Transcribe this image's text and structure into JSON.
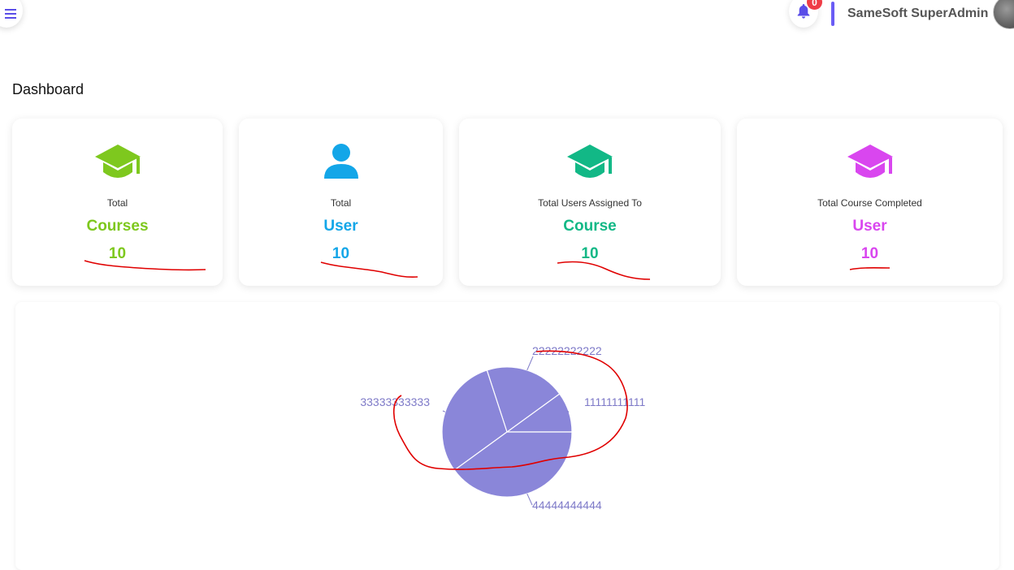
{
  "header": {
    "user_name": "SameSoft SuperAdmin",
    "notification_count": "0",
    "accent_color": "#6a5cf5"
  },
  "page": {
    "title": "Dashboard"
  },
  "cards": [
    {
      "icon": "graduation-cap-icon",
      "small": "Total",
      "big": "Courses",
      "value": "10",
      "color": "#7ec81e"
    },
    {
      "icon": "user-icon",
      "small": "Total",
      "big": "User",
      "value": "10",
      "color": "#13a6e8"
    },
    {
      "icon": "graduation-cap-icon",
      "small": "Total Users Assigned To",
      "big": "Course",
      "value": "10",
      "color": "#12b886"
    },
    {
      "icon": "graduation-cap-icon",
      "small": "Total Course Completed",
      "big": "User",
      "value": "10",
      "color": "#d946ef"
    }
  ],
  "chart_data": {
    "type": "pie",
    "categories": [
      "11111111111",
      "22222222222",
      "33333333333",
      "44444444444"
    ],
    "values": [
      1,
      2,
      3,
      4
    ],
    "color": "#8a86d9",
    "label_color": "#7e7ac8"
  }
}
